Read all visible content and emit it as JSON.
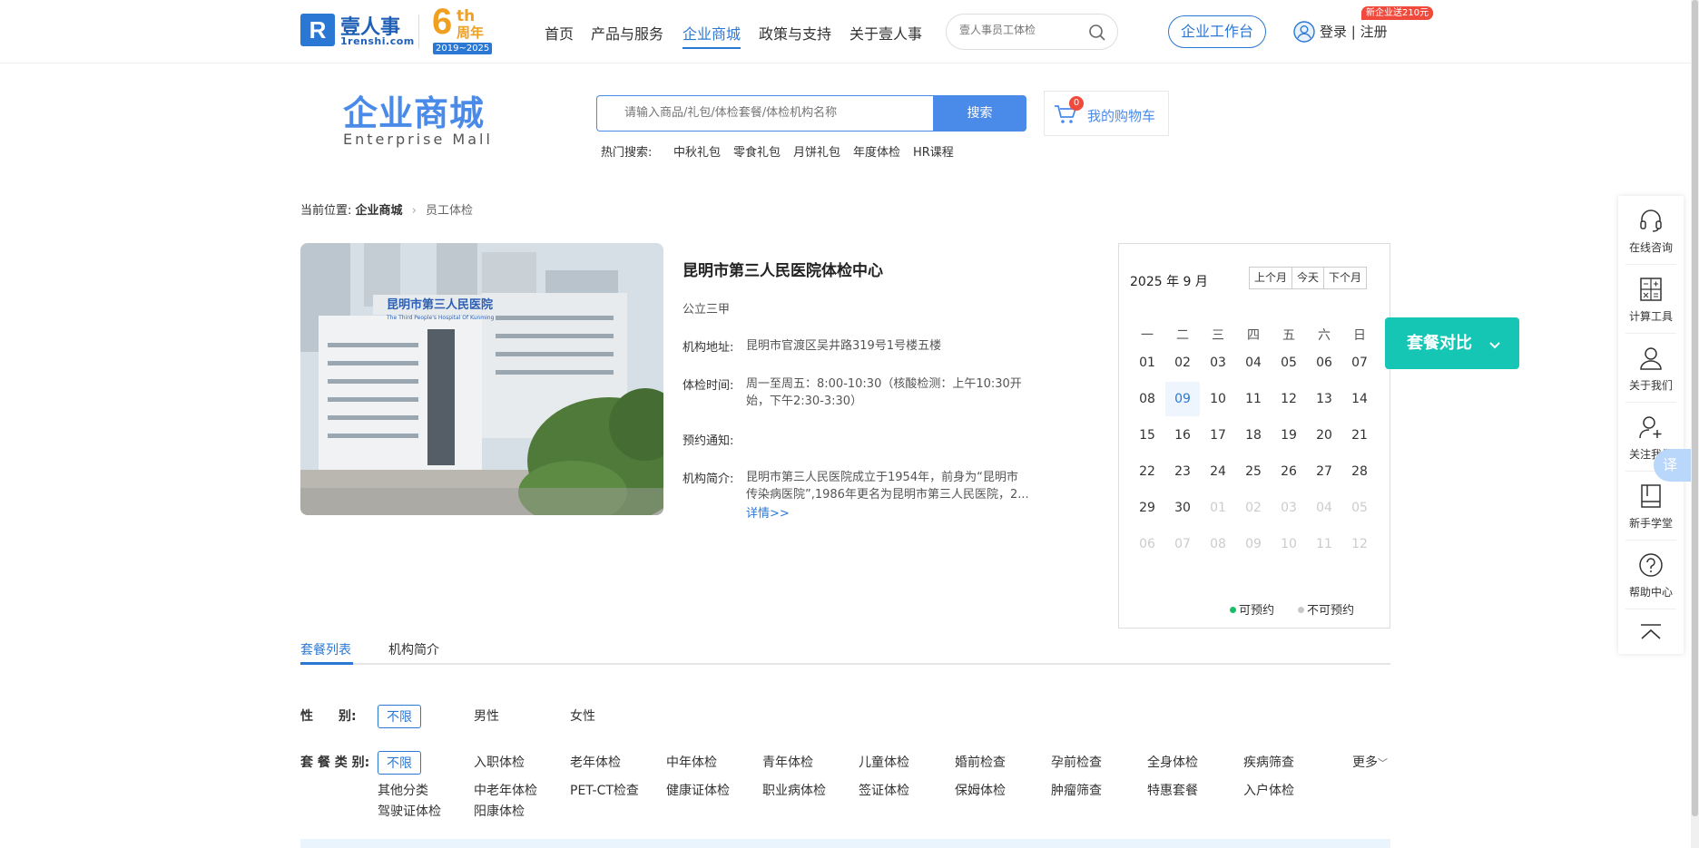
{
  "header": {
    "logo_mark": "R",
    "logo_name": "壹人事",
    "logo_domain": "1renshi.com",
    "anniversary": {
      "num": "6",
      "th": "th",
      "zh": "周年",
      "years": "2019~2025"
    },
    "nav": [
      "首页",
      "产品与服务",
      "企业商城",
      "政策与支持",
      "关于壹人事"
    ],
    "search_placeholder": "壹人事员工体检",
    "workbench": "企业工作台",
    "login": "登录 | 注册",
    "promo": "新企业送210元"
  },
  "mall": {
    "title": "企业商城",
    "subtitle": "Enterprise  Mall",
    "search_placeholder": "请输入商品/礼包/体检套餐/体检机构名称",
    "search_button": "搜索",
    "cart_count": "0",
    "cart_label": "我的购物车",
    "hot_label": "热门搜索:",
    "hot_items": [
      "中秋礼包",
      "零食礼包",
      "月饼礼包",
      "年度体检",
      "HR课程"
    ]
  },
  "breadcrumb": {
    "prefix": "当前位置:",
    "parent": "企业商城",
    "current": "员工体检"
  },
  "hospital": {
    "name": "昆明市第三人民医院体检中心",
    "level": "公立三甲",
    "photo_sign_zh": "昆明市第三人民医院",
    "photo_sign_en": "The Third People's Hospital Of Kunming",
    "address_label": "机构地址:",
    "address": "昆明市官渡区吴井路319号1号楼五楼",
    "hours_label": "体检时间:",
    "hours_line1": "周一至周五：8:00-10:30（核酸检测：上午10:30开",
    "hours_line2": "始，下午2:30-3:30）",
    "notice_label": "预约通知:",
    "intro_label": "机构简介:",
    "intro_line1": "昆明市第三人民医院成立于1954年，前身为“昆明市",
    "intro_line2": "传染病医院”,1986年更名为昆明市第三人民医院，2...",
    "more": "详情>>"
  },
  "calendar": {
    "title": "2025 年 9 月",
    "buttons": [
      "上个月",
      "今天",
      "下个月"
    ],
    "weekdays": [
      "一",
      "二",
      "三",
      "四",
      "五",
      "六",
      "日"
    ],
    "weeks": [
      [
        "01",
        "02",
        "03",
        "04",
        "05",
        "06",
        "07"
      ],
      [
        "08",
        "09",
        "10",
        "11",
        "12",
        "13",
        "14"
      ],
      [
        "15",
        "16",
        "17",
        "18",
        "19",
        "20",
        "21"
      ],
      [
        "22",
        "23",
        "24",
        "25",
        "26",
        "27",
        "28"
      ],
      [
        "29",
        "30",
        "01",
        "02",
        "03",
        "04",
        "05"
      ],
      [
        "06",
        "07",
        "08",
        "09",
        "10",
        "11",
        "12"
      ]
    ],
    "today": "09",
    "legend_available": "可预约",
    "legend_unavailable": "不可预约",
    "available_color": "#19be6b",
    "unavailable_color": "#c8c8c8"
  },
  "compare_button": "套餐对比",
  "sidebar": [
    "在线咨询",
    "计算工具",
    "关于我们",
    "关注我们",
    "新手学堂",
    "帮助中心"
  ],
  "translate": "译",
  "tabs": [
    "套餐列表",
    "机构简介"
  ],
  "filters": {
    "gender_label": "性　　别:",
    "gender": [
      "不限",
      "男性",
      "女性"
    ],
    "category_label": "套 餐 类 别:",
    "category_row1": [
      "不限",
      "入职体检",
      "老年体检",
      "中年体检",
      "青年体检",
      "儿童体检",
      "婚前检查",
      "孕前检查",
      "全身体检",
      "疾病筛查"
    ],
    "more": "更多",
    "category_row2": [
      "其他分类",
      "中老年体检",
      "PET-CT检查",
      "健康证体检",
      "职业病体检",
      "签证体检",
      "保姆体检",
      "肿瘤筛查",
      "特惠套餐",
      "入户体检"
    ],
    "category_row3": [
      "驾驶证体检",
      "阳康体检"
    ]
  },
  "colors": {
    "brand": "#2b78d4",
    "mall_blue": "#4a8ae8",
    "compare": "#15c6b4",
    "badge": "#ef4a3c"
  }
}
